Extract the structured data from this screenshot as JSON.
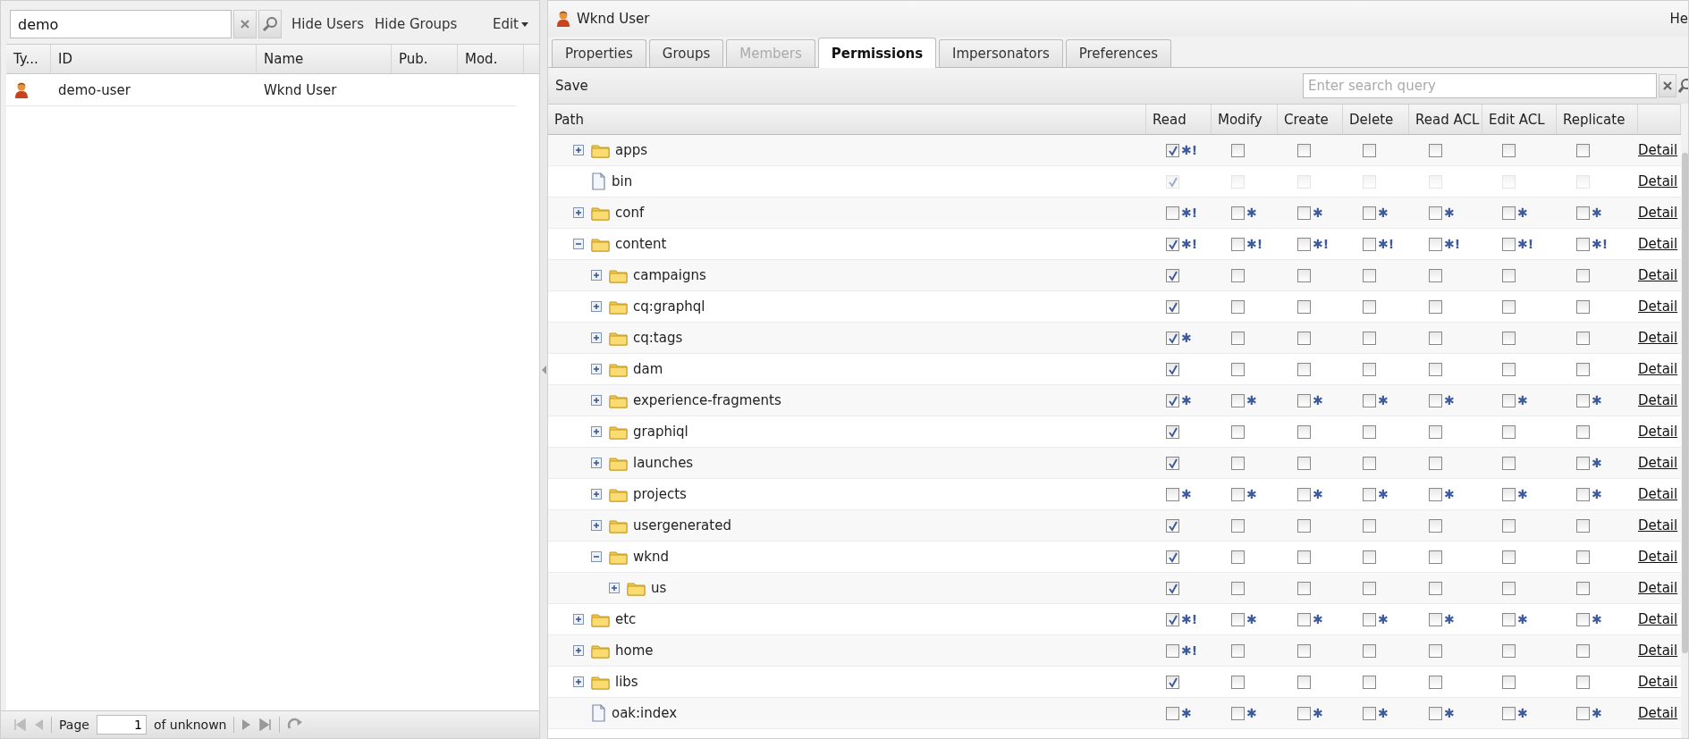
{
  "left_panel": {
    "search": {
      "value": "demo"
    },
    "filters": [
      "Hide Users",
      "Hide Groups"
    ],
    "edit_menu": "Edit",
    "table": {
      "columns": [
        "Ty...",
        "ID",
        "Name",
        "Pub.",
        "Mod."
      ],
      "rows": [
        {
          "kind": "user",
          "id": "demo-user",
          "name": "Wknd User",
          "selected": false
        }
      ]
    },
    "paging": {
      "label": "Page",
      "page": "1",
      "total": "of unknown"
    }
  },
  "editor": {
    "title": "Wknd User",
    "corner_text": "He",
    "tabs": [
      {
        "label": "Properties",
        "selected": false,
        "disabled": false
      },
      {
        "label": "Groups",
        "selected": false,
        "disabled": false
      },
      {
        "label": "Members",
        "selected": false,
        "disabled": true
      },
      {
        "label": "Permissions",
        "selected": true,
        "disabled": false
      },
      {
        "label": "Impersonators",
        "selected": false,
        "disabled": false
      },
      {
        "label": "Preferences",
        "selected": false,
        "disabled": false
      }
    ],
    "toolbar": {
      "save": "Save",
      "search": {
        "placeholder": "Enter search query"
      }
    },
    "permissions": {
      "columns": [
        "Path",
        "Read",
        "Modify",
        "Create",
        "Delete",
        "Read ACL",
        "Edit ACL",
        "Replicate"
      ],
      "rows": [
        {
          "name": "apps",
          "kind": "folder",
          "expanded": false,
          "disabled": false,
          "detail": "Detail",
          "perms": [
            {
              "checked": true,
              "mark": "✱!"
            },
            {
              "checked": false
            },
            {
              "checked": false
            },
            {
              "checked": false
            },
            {
              "checked": false
            },
            {
              "checked": false
            },
            {
              "checked": false
            }
          ]
        },
        {
          "name": "bin",
          "kind": "file",
          "disabled": true,
          "detail": "Detail",
          "perms": [
            {
              "checked": true
            },
            {
              "checked": false
            },
            {
              "checked": false
            },
            {
              "checked": false
            },
            {
              "checked": false
            },
            {
              "checked": false
            },
            {
              "checked": false
            }
          ]
        },
        {
          "name": "conf",
          "kind": "folder",
          "expanded": false,
          "disabled": false,
          "detail": "Detail",
          "perms": [
            {
              "checked": false,
              "mark": "✱!"
            },
            {
              "checked": false,
              "mark": "✱"
            },
            {
              "checked": false,
              "mark": "✱"
            },
            {
              "checked": false,
              "mark": "✱"
            },
            {
              "checked": false,
              "mark": "✱"
            },
            {
              "checked": false,
              "mark": "✱"
            },
            {
              "checked": false,
              "mark": "✱"
            }
          ]
        },
        {
          "name": "content",
          "kind": "folder",
          "expanded": true,
          "disabled": false,
          "detail": "Detail",
          "perms": [
            {
              "checked": true,
              "mark": "✱!"
            },
            {
              "checked": false,
              "mark": "✱!"
            },
            {
              "checked": false,
              "mark": "✱!"
            },
            {
              "checked": false,
              "mark": "✱!"
            },
            {
              "checked": false,
              "mark": "✱!"
            },
            {
              "checked": false,
              "mark": "✱!"
            },
            {
              "checked": false,
              "mark": "✱!"
            }
          ],
          "children": [
            {
              "name": "campaigns",
              "kind": "folder",
              "expanded": false,
              "disabled": false,
              "detail": "Detail",
              "perms": [
                {
                  "checked": true
                },
                {
                  "checked": false
                },
                {
                  "checked": false
                },
                {
                  "checked": false
                },
                {
                  "checked": false
                },
                {
                  "checked": false
                },
                {
                  "checked": false
                }
              ]
            },
            {
              "name": "cq:graphql",
              "kind": "folder",
              "expanded": false,
              "disabled": false,
              "detail": "Detail",
              "perms": [
                {
                  "checked": true
                },
                {
                  "checked": false
                },
                {
                  "checked": false
                },
                {
                  "checked": false
                },
                {
                  "checked": false
                },
                {
                  "checked": false
                },
                {
                  "checked": false
                }
              ]
            },
            {
              "name": "cq:tags",
              "kind": "folder",
              "expanded": false,
              "disabled": false,
              "detail": "Detail",
              "perms": [
                {
                  "checked": true,
                  "mark": "✱"
                },
                {
                  "checked": false
                },
                {
                  "checked": false
                },
                {
                  "checked": false
                },
                {
                  "checked": false
                },
                {
                  "checked": false
                },
                {
                  "checked": false
                }
              ]
            },
            {
              "name": "dam",
              "kind": "folder",
              "expanded": false,
              "disabled": false,
              "detail": "Detail",
              "perms": [
                {
                  "checked": true
                },
                {
                  "checked": false
                },
                {
                  "checked": false
                },
                {
                  "checked": false
                },
                {
                  "checked": false
                },
                {
                  "checked": false
                },
                {
                  "checked": false
                }
              ]
            },
            {
              "name": "experience-fragments",
              "kind": "folder",
              "expanded": false,
              "disabled": false,
              "detail": "Detail",
              "perms": [
                {
                  "checked": true,
                  "mark": "✱"
                },
                {
                  "checked": false,
                  "mark": "✱"
                },
                {
                  "checked": false,
                  "mark": "✱"
                },
                {
                  "checked": false,
                  "mark": "✱"
                },
                {
                  "checked": false,
                  "mark": "✱"
                },
                {
                  "checked": false,
                  "mark": "✱"
                },
                {
                  "checked": false,
                  "mark": "✱"
                }
              ]
            },
            {
              "name": "graphiql",
              "kind": "folder",
              "expanded": false,
              "disabled": false,
              "detail": "Detail",
              "perms": [
                {
                  "checked": true
                },
                {
                  "checked": false
                },
                {
                  "checked": false
                },
                {
                  "checked": false
                },
                {
                  "checked": false
                },
                {
                  "checked": false
                },
                {
                  "checked": false
                }
              ]
            },
            {
              "name": "launches",
              "kind": "folder",
              "expanded": false,
              "disabled": false,
              "detail": "Detail",
              "perms": [
                {
                  "checked": true
                },
                {
                  "checked": false
                },
                {
                  "checked": false
                },
                {
                  "checked": false
                },
                {
                  "checked": false
                },
                {
                  "checked": false
                },
                {
                  "checked": false,
                  "mark": "✱"
                }
              ]
            },
            {
              "name": "projects",
              "kind": "folder",
              "expanded": false,
              "disabled": false,
              "detail": "Detail",
              "perms": [
                {
                  "checked": false,
                  "mark": "✱"
                },
                {
                  "checked": false,
                  "mark": "✱"
                },
                {
                  "checked": false,
                  "mark": "✱"
                },
                {
                  "checked": false,
                  "mark": "✱"
                },
                {
                  "checked": false,
                  "mark": "✱"
                },
                {
                  "checked": false,
                  "mark": "✱"
                },
                {
                  "checked": false,
                  "mark": "✱"
                }
              ]
            },
            {
              "name": "usergenerated",
              "kind": "folder",
              "expanded": false,
              "disabled": false,
              "detail": "Detail",
              "perms": [
                {
                  "checked": true
                },
                {
                  "checked": false
                },
                {
                  "checked": false
                },
                {
                  "checked": false
                },
                {
                  "checked": false
                },
                {
                  "checked": false
                },
                {
                  "checked": false
                }
              ]
            },
            {
              "name": "wknd",
              "kind": "folder",
              "expanded": true,
              "disabled": false,
              "detail": "Detail",
              "perms": [
                {
                  "checked": true
                },
                {
                  "checked": false
                },
                {
                  "checked": false
                },
                {
                  "checked": false
                },
                {
                  "checked": false
                },
                {
                  "checked": false
                },
                {
                  "checked": false
                }
              ],
              "children": [
                {
                  "name": "us",
                  "kind": "folder",
                  "expanded": false,
                  "disabled": false,
                  "detail": "Detail",
                  "perms": [
                    {
                      "checked": true
                    },
                    {
                      "checked": false
                    },
                    {
                      "checked": false
                    },
                    {
                      "checked": false
                    },
                    {
                      "checked": false
                    },
                    {
                      "checked": false
                    },
                    {
                      "checked": false
                    }
                  ]
                }
              ]
            }
          ]
        },
        {
          "name": "etc",
          "kind": "folder",
          "expanded": false,
          "disabled": false,
          "detail": "Detail",
          "perms": [
            {
              "checked": true,
              "mark": "✱!"
            },
            {
              "checked": false,
              "mark": "✱"
            },
            {
              "checked": false,
              "mark": "✱"
            },
            {
              "checked": false,
              "mark": "✱"
            },
            {
              "checked": false,
              "mark": "✱"
            },
            {
              "checked": false,
              "mark": "✱"
            },
            {
              "checked": false,
              "mark": "✱"
            }
          ]
        },
        {
          "name": "home",
          "kind": "folder",
          "expanded": false,
          "disabled": false,
          "detail": "Detail",
          "perms": [
            {
              "checked": false,
              "mark": "✱!"
            },
            {
              "checked": false
            },
            {
              "checked": false
            },
            {
              "checked": false
            },
            {
              "checked": false
            },
            {
              "checked": false
            },
            {
              "checked": false
            }
          ]
        },
        {
          "name": "libs",
          "kind": "folder",
          "expanded": false,
          "disabled": false,
          "detail": "Detail",
          "perms": [
            {
              "checked": true
            },
            {
              "checked": false
            },
            {
              "checked": false
            },
            {
              "checked": false
            },
            {
              "checked": false
            },
            {
              "checked": false
            },
            {
              "checked": false
            }
          ]
        },
        {
          "name": "oak:index",
          "kind": "file",
          "disabled": false,
          "detail": "Detail",
          "perms": [
            {
              "checked": false,
              "mark": "✱"
            },
            {
              "checked": false,
              "mark": "✱"
            },
            {
              "checked": false,
              "mark": "✱"
            },
            {
              "checked": false,
              "mark": "✱"
            },
            {
              "checked": false,
              "mark": "✱"
            },
            {
              "checked": false,
              "mark": "✱"
            },
            {
              "checked": false,
              "mark": "✱"
            }
          ]
        }
      ]
    }
  }
}
